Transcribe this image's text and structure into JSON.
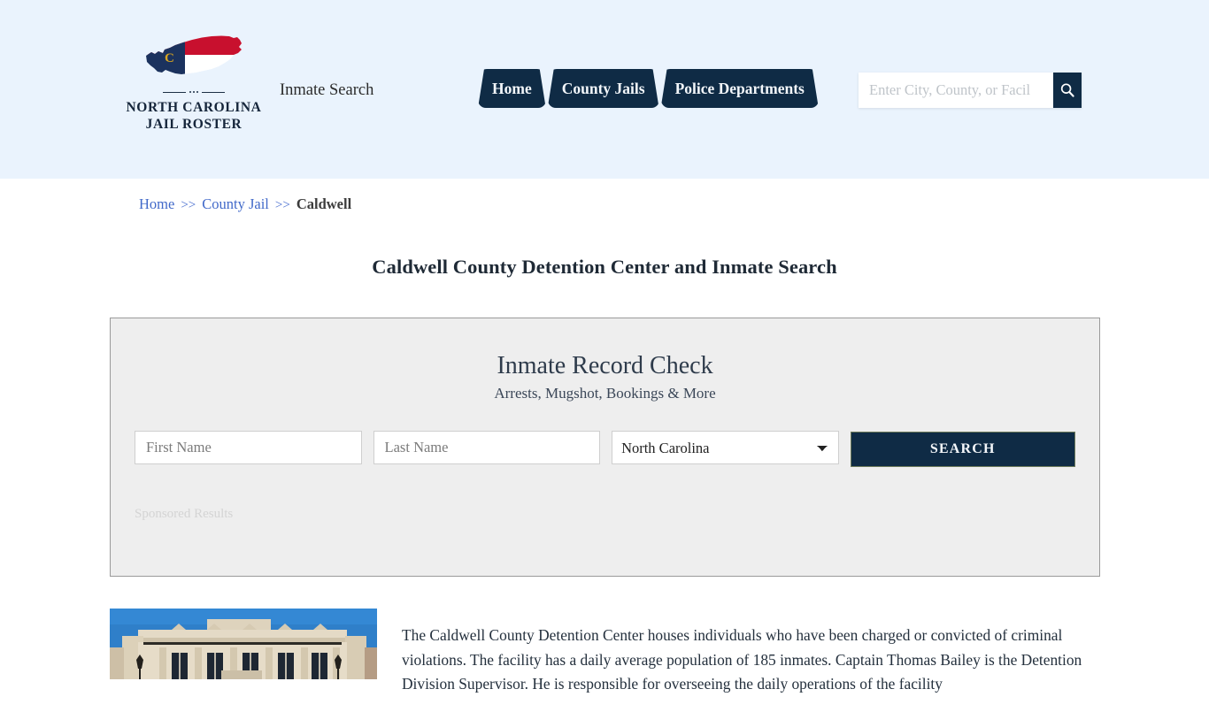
{
  "colors": {
    "header_bg": "#eaf3fd",
    "navy": "#0f2b45",
    "link_blue": "#4169c9",
    "widget_bg": "#eeeeee",
    "flag_red": "#c8102e",
    "flag_gold": "#d9a520"
  },
  "header": {
    "brand": {
      "logo_icon": "north-carolina-state-map",
      "name_line1": "NORTH CAROLINA",
      "name_line2": "JAIL ROSTER",
      "flag_letter": "C"
    },
    "tagline": "Inmate Search",
    "nav": [
      {
        "label": "Home"
      },
      {
        "label": "County Jails"
      },
      {
        "label": "Police Departments"
      }
    ],
    "search": {
      "value": "",
      "placeholder": "Enter City, County, or Facil",
      "button_icon": "search-icon"
    }
  },
  "breadcrumb": {
    "items": [
      {
        "label": "Home",
        "link": true
      },
      {
        "label": "County Jail",
        "link": true
      },
      {
        "label": "Caldwell",
        "link": false
      }
    ],
    "separator": ">>"
  },
  "page": {
    "title": "Caldwell County Detention Center and Inmate Search"
  },
  "widget": {
    "title": "Inmate Record Check",
    "subtitle": "Arrests, Mugshot, Bookings & More",
    "first_name": {
      "value": "",
      "placeholder": "First Name"
    },
    "last_name": {
      "value": "",
      "placeholder": "Last Name"
    },
    "state": {
      "selected": "North Carolina",
      "options": [
        "North Carolina"
      ]
    },
    "search_button": "SEARCH",
    "sponsored_label": "Sponsored Results"
  },
  "content": {
    "photo_alt": "caldwell-county-detention-center-building",
    "body": "The Caldwell County Detention Center houses individuals who have been charged or convicted of criminal violations. The facility has a daily average population of 185 inmates. Captain Thomas Bailey is the Detention Division Supervisor. He is responsible for overseeing the daily operations of the facility"
  }
}
